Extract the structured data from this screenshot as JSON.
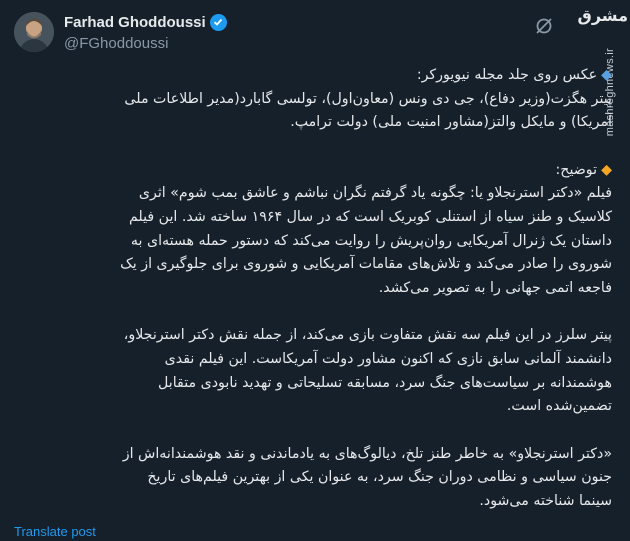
{
  "author": {
    "display_name": "Farhad Ghoddoussi",
    "handle": "@FGhoddoussi",
    "verified": true
  },
  "watermark": {
    "logo_text": "مشرق",
    "site_url": "mashreghnews.ir"
  },
  "tweet": {
    "heading": {
      "bullet": "🔹",
      "lines": [
        "عکس روی جلد مجله نیویورکر:",
        "پیتر هگزت(وزیر دفاع)، جی دی ونس (معاون‌اول)، تولسی گابارد(مدیر اطلاعات ملی",
        "آمریکا) و مایکل والتز(مشاور امنیت ملی)  دولت ترامپ."
      ]
    },
    "explanation": {
      "bullet": "🔸",
      "lines": [
        "توضیح:",
        "فیلم «دکتر استرنجلاو یا: چگونه یاد گرفتم نگران نباشم و عاشق بمب شوم» اثری",
        "کلاسیک و طنز سیاه از استنلی کوبریک است که در سال ۱۹۶۴ ساخته شد. این فیلم",
        "داستان یک ژنرال آمریکایی روان‌پریش را روایت می‌کند که دستور حمله هسته‌ای به",
        "شوروی را صادر می‌کند و تلاش‌های مقامات آمریکایی و شوروی برای جلوگیری از یک",
        "فاجعه اتمی جهانی را به تصویر می‌کشد."
      ]
    },
    "paragraph2": {
      "lines": [
        "پیتر سلرز در این فیلم سه نقش متفاوت بازی می‌کند، از جمله نقش دکتر استرنجلاو،",
        "دانشمند آلمانی سابق نازی که اکنون مشاور دولت آمریکاست. این فیلم نقدی",
        "هوشمندانه بر سیاست‌های جنگ سرد، مسابقه تسلیحاتی و تهدید نابودی متقابل",
        "تضمین‌شده است."
      ]
    },
    "paragraph3": {
      "lines": [
        "«دکتر استرنجلاو» به خاطر طنز تلخ، دیالوگ‌های به یادماندنی و نقد هوشمندانه‌اش از",
        "جنون سیاسی و نظامی دوران جنگ سرد، به عنوان یکی از بهترین فیلم‌های تاریخ",
        "سینما شناخته می‌شود."
      ]
    }
  },
  "actions": {
    "translate_label": "Translate post"
  },
  "colors": {
    "background": "#15202b",
    "text": "#e7e9ea",
    "secondary_text": "#8b98a5",
    "accent": "#1d9bf0"
  }
}
